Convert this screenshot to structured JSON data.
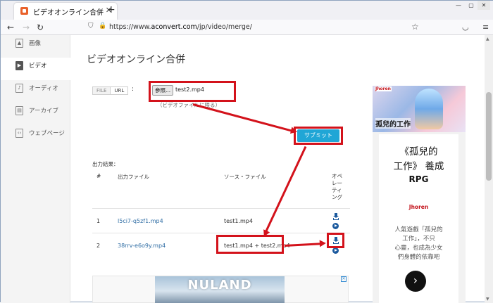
{
  "browser": {
    "tab_title": "ビデオオンライン合併",
    "tab_close": "✕",
    "new_tab": "+",
    "win_min": "—",
    "win_max": "▢",
    "win_close": "✕",
    "back": "←",
    "forward": "→",
    "reload": "↻",
    "url_prefix": "https://www.",
    "url_domain": "aconvert.com",
    "url_path": "/jp/video/merge/",
    "star": "☆",
    "icons": [
      "shield-icon",
      "lock-icon",
      "bookmark-star-icon",
      "pocket-icon",
      "menu-icon"
    ]
  },
  "sidebar": {
    "items": [
      {
        "label": "画像",
        "icon": "image-icon"
      },
      {
        "label": "ビデオ",
        "icon": "video-icon",
        "active": true
      },
      {
        "label": "オーディオ",
        "icon": "audio-icon"
      },
      {
        "label": "アーカイブ",
        "icon": "archive-icon"
      },
      {
        "label": "ウェブページ",
        "icon": "webpage-icon"
      }
    ]
  },
  "main": {
    "title": "ビデオオンライン合併",
    "mode_file": "FILE",
    "mode_url": "URL",
    "colon": ":",
    "browse_label": "参照...",
    "selected_file": "test2.mp4",
    "note": "（ビデオファイルに限る）",
    "submit_label": "サブミット",
    "output_label": "出力結果："
  },
  "table": {
    "headers": [
      "#",
      "出力ファイル",
      "ソース・ファイル",
      "オペレーティング"
    ],
    "op_header_lines": [
      "オペ",
      "レー",
      "ティ",
      "ング"
    ],
    "rows": [
      {
        "num": "1",
        "output": "l5ci7-q5zf1.mp4",
        "source": "test1.mp4"
      },
      {
        "num": "2",
        "output": "38rrv-e6o9y.mp4",
        "source": "test1.mp4 + test2.mp4"
      }
    ]
  },
  "bottom_ad": {
    "text": "NULAND",
    "close": "✕"
  },
  "right_ad": {
    "brand": "Jhoren",
    "image_title": "孤兒的工作",
    "headline1": "《孤兒的",
    "headline2": "工作》 養成",
    "genre": "RPG",
    "logo": "Jhoren",
    "line1": "人氣遊戲「孤兒的",
    "line2": "工作」，不只",
    "line3": "心靈，也成為少女",
    "line4": "們身體的依靠吧",
    "go": "›"
  },
  "colors": {
    "accent": "#20a6d6",
    "annotation": "#d3121b",
    "link": "#2f6da4"
  }
}
